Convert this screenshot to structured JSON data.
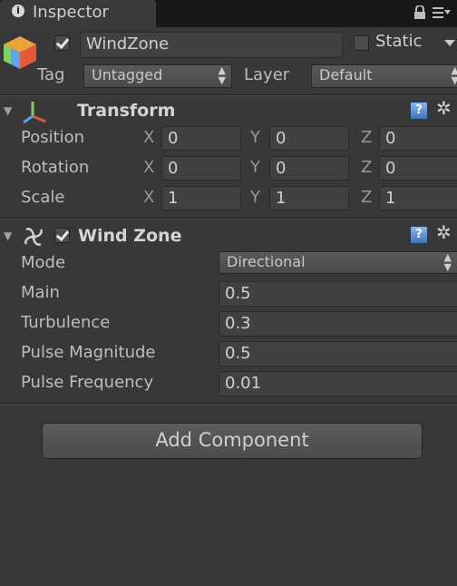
{
  "tab": {
    "title": "Inspector"
  },
  "header": {
    "active": true,
    "name": "WindZone",
    "static_label": "Static",
    "static_checked": false,
    "tag_label": "Tag",
    "tag_value": "Untagged",
    "layer_label": "Layer",
    "layer_value": "Default"
  },
  "transform": {
    "title": "Transform",
    "rows": [
      {
        "label": "Position",
        "x": "0",
        "y": "0",
        "z": "0"
      },
      {
        "label": "Rotation",
        "x": "0",
        "y": "0",
        "z": "0"
      },
      {
        "label": "Scale",
        "x": "1",
        "y": "1",
        "z": "1"
      }
    ],
    "axes": [
      "X",
      "Y",
      "Z"
    ]
  },
  "windzone": {
    "title": "Wind Zone",
    "enabled": true,
    "mode_label": "Mode",
    "mode_value": "Directional",
    "props": [
      {
        "label": "Main",
        "value": "0.5"
      },
      {
        "label": "Turbulence",
        "value": "0.3"
      },
      {
        "label": "Pulse Magnitude",
        "value": "0.5"
      },
      {
        "label": "Pulse Frequency",
        "value": "0.01"
      }
    ]
  },
  "add_component_label": "Add Component",
  "icons": {
    "tab": "info-icon",
    "lock": "lock-icon",
    "menu": "menu-icon",
    "gameobject": "cube-icon",
    "transform": "transform-axes-icon",
    "windzone": "wind-zone-icon",
    "help": "help-icon",
    "settings": "gear-icon"
  }
}
